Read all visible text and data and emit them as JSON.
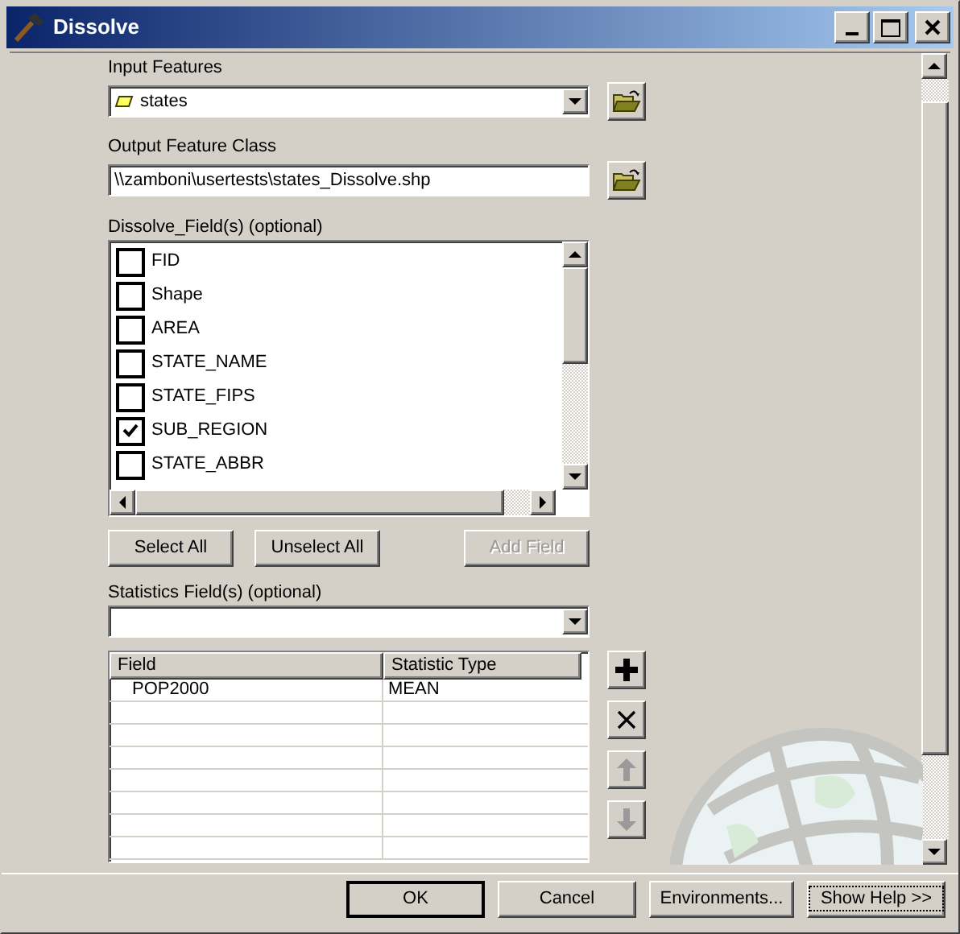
{
  "window": {
    "title": "Dissolve"
  },
  "input_features": {
    "label": "Input Features",
    "value": "states"
  },
  "output_feature_class": {
    "label": "Output Feature Class",
    "value": "\\\\zamboni\\usertests\\states_Dissolve.shp"
  },
  "dissolve_fields": {
    "label": "Dissolve_Field(s) (optional)",
    "items": [
      {
        "label": "FID",
        "checked": false
      },
      {
        "label": "Shape",
        "checked": false
      },
      {
        "label": "AREA",
        "checked": false
      },
      {
        "label": "STATE_NAME",
        "checked": false
      },
      {
        "label": "STATE_FIPS",
        "checked": false
      },
      {
        "label": "SUB_REGION",
        "checked": true
      },
      {
        "label": "STATE_ABBR",
        "checked": false
      }
    ]
  },
  "list_buttons": [
    {
      "label": "Select All",
      "disabled": false
    },
    {
      "label": "Unselect All",
      "disabled": false
    },
    {
      "label": "Add Field",
      "disabled": true
    }
  ],
  "statistics_fields": {
    "label": "Statistics Field(s) (optional)",
    "columns": [
      "Field",
      "Statistic Type"
    ],
    "rows": [
      [
        "POP2000",
        "MEAN"
      ]
    ]
  },
  "side_tools": [
    {
      "kind": "add",
      "disabled": false
    },
    {
      "kind": "remove",
      "disabled": false
    },
    {
      "kind": "up",
      "disabled": true
    },
    {
      "kind": "down",
      "disabled": true
    }
  ],
  "buttons": [
    {
      "label": "OK",
      "default": true,
      "focused": false
    },
    {
      "label": "Cancel",
      "default": false,
      "focused": false
    },
    {
      "label": "Environments...",
      "default": false,
      "focused": false
    },
    {
      "label": "Show Help >>",
      "default": false,
      "focused": true
    }
  ]
}
